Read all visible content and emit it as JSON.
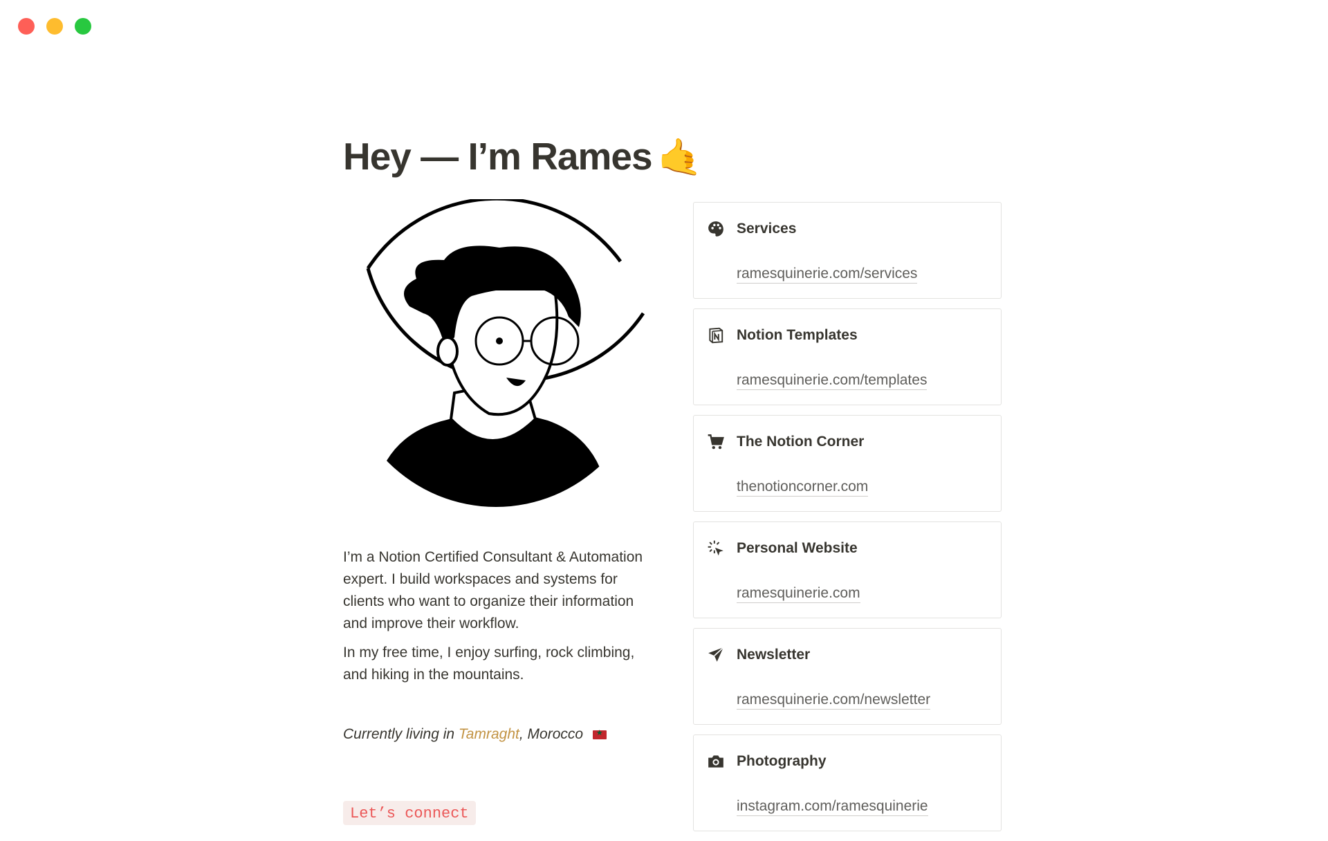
{
  "window": {
    "controls": [
      "close",
      "minimize",
      "zoom"
    ]
  },
  "header": {
    "title": "Hey — I’m Rames",
    "title_emoji": "🤙"
  },
  "profile": {
    "avatar_icon": "portrait-illustration",
    "bio": [
      "I’m a Notion Certified Consultant & Automation expert. I build workspaces and systems for clients who want to organize their information and improve their workflow.",
      "In my free time, I enjoy surfing, rock climbing, and hiking in the mountains."
    ],
    "location": {
      "prefix": "Currently living in",
      "city": "Tamraght",
      "separator": ",",
      "country": "Morocco",
      "flag_icon": "morocco-flag-icon",
      "city_color": "#c29343"
    },
    "connect_label": "Let’s connect"
  },
  "links": [
    {
      "title": "Services",
      "url": "ramesquinerie.com/services",
      "icon": "palette-icon"
    },
    {
      "title": "Notion Templates",
      "url": "ramesquinerie.com/templates",
      "icon": "notion-icon"
    },
    {
      "title": "The Notion Corner",
      "url": "thenotioncorner.com",
      "icon": "cart-icon"
    },
    {
      "title": "Personal Website",
      "url": "ramesquinerie.com",
      "icon": "cursor-click-icon"
    },
    {
      "title": "Newsletter",
      "url": "ramesquinerie.com/newsletter",
      "icon": "paper-plane-icon"
    },
    {
      "title": "Photography",
      "url": "instagram.com/ramesquinerie",
      "icon": "camera-icon"
    }
  ],
  "colors": {
    "text": "#37352f",
    "muted": "#5f5e5b",
    "code_red": "#eb5757",
    "code_bg": "#f7ecea",
    "border": "#e3e2e0"
  }
}
